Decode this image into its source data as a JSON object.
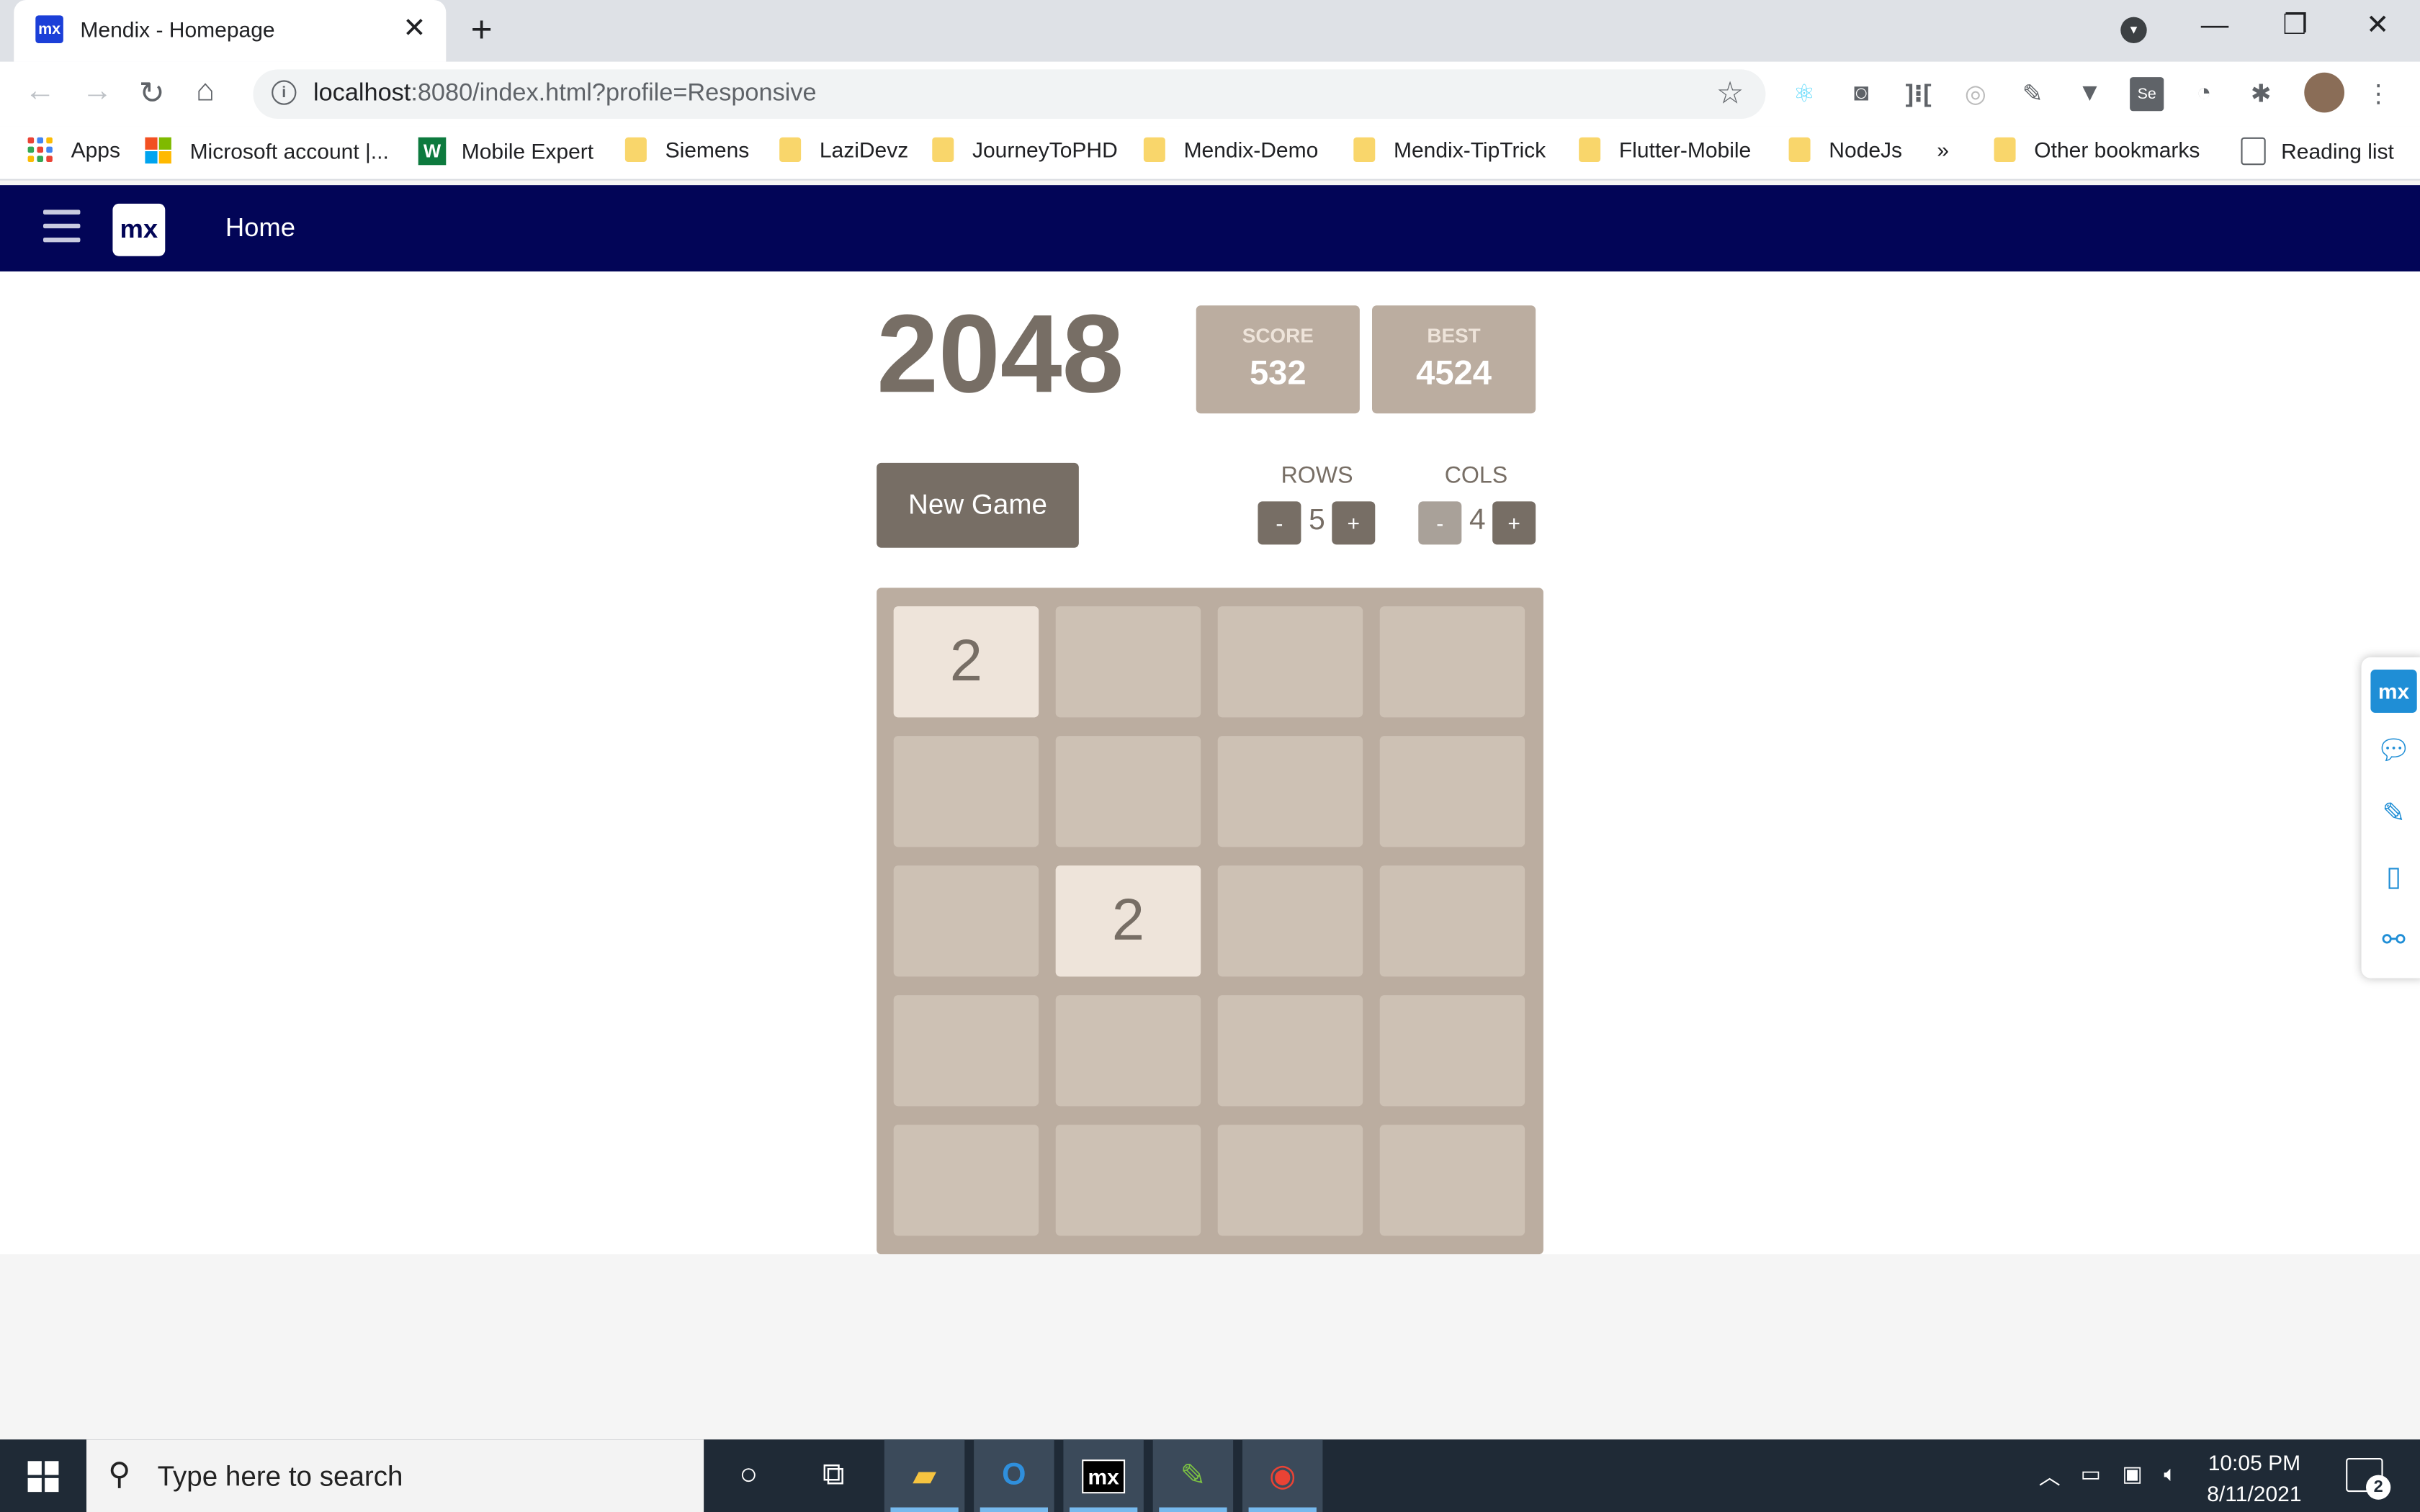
{
  "browser": {
    "tab_title": "Mendix - Homepage",
    "tab_favicon_text": "mx",
    "new_tab_symbol": "+",
    "url_host": "localhost",
    "url_path": ":8080/index.html?profile=Responsive"
  },
  "bookmarks": {
    "apps": "Apps",
    "items": [
      "Microsoft account |...",
      "Mobile Expert",
      "Siemens",
      "LaziDevz",
      "JourneyToPHD",
      "Mendix-Demo",
      "Mendix-TipTrick",
      "Flutter-Mobile",
      "NodeJs"
    ],
    "more": "»",
    "other": "Other bookmarks",
    "reading_list": "Reading list"
  },
  "app": {
    "logo": "mx",
    "nav_home": "Home"
  },
  "game": {
    "title": "2048",
    "score_label": "SCORE",
    "score": "532",
    "best_label": "BEST",
    "best": "4524",
    "new_game_label": "New Game",
    "rows_label": "ROWS",
    "rows": "5",
    "cols_label": "COLS",
    "cols": "4",
    "minus": "-",
    "plus": "+",
    "grid": [
      [
        2,
        0,
        0,
        0
      ],
      [
        0,
        0,
        0,
        0
      ],
      [
        0,
        2,
        0,
        0
      ],
      [
        0,
        0,
        0,
        0
      ],
      [
        0,
        0,
        0,
        0
      ]
    ],
    "colors": {
      "board": "#bbada0",
      "cell": "#cdc1b4",
      "tile_2": "#eee4da",
      "text": "#776e65",
      "header": "#020557"
    }
  },
  "side_panel": {
    "logo": "mx",
    "icons": [
      "chat-icon",
      "pencil-icon",
      "mobile-icon",
      "share-icon"
    ]
  },
  "taskbar": {
    "search_placeholder": "Type here to search",
    "time": "10:05 PM",
    "date": "8/11/2021",
    "notification_count": "2",
    "mx_label": "mx"
  }
}
